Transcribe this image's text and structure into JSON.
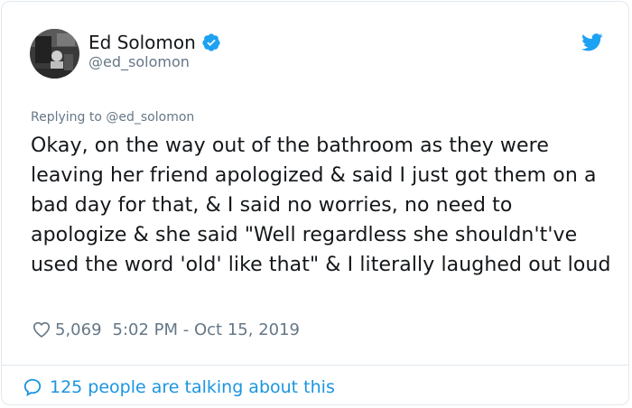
{
  "author": {
    "display_name": "Ed Solomon",
    "handle": "@ed_solomon",
    "verified": true,
    "avatar_icon": "avatar-photo"
  },
  "reply": {
    "prefix": "Replying to",
    "mention": "@ed_solomon"
  },
  "tweet": {
    "text": "Okay, on the way out of the bathroom as they were leaving her friend apologized & said I just got them on a bad day for that, & I said no worries, no need to apologize & she said \"Well regardless she shouldn't've used the word 'old' like that\" & I literally laughed out loud"
  },
  "meta": {
    "likes": "5,069",
    "timestamp": "5:02 PM - Oct 15, 2019"
  },
  "footer": {
    "talking": "125 people are talking about this"
  },
  "colors": {
    "twitter_blue": "#1da1f2",
    "link_blue": "#1b95e0",
    "secondary_gray": "#657786",
    "text": "#14171a",
    "border": "#e1e8ed"
  }
}
